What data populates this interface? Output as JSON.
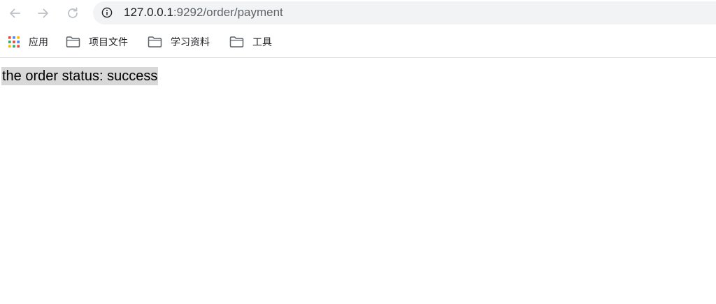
{
  "browser": {
    "address_bar": {
      "host": "127.0.0.1",
      "rest": ":9292/order/payment",
      "icon": "info-icon"
    },
    "nav": {
      "back_icon": "arrow-left-icon",
      "forward_icon": "arrow-right-icon",
      "reload_icon": "reload-icon"
    },
    "bookmarks": [
      {
        "label": "应用",
        "icon": "apps-grid-icon"
      },
      {
        "label": "项目文件",
        "icon": "folder-icon"
      },
      {
        "label": "学习资料",
        "icon": "folder-icon"
      },
      {
        "label": "工具",
        "icon": "folder-icon"
      }
    ]
  },
  "page": {
    "status_text": "the order status: success"
  },
  "colors": {
    "omnibox_bg": "#f1f3f4",
    "selection_bg": "#d8d8d8",
    "icon_gray": "#5f6368"
  }
}
